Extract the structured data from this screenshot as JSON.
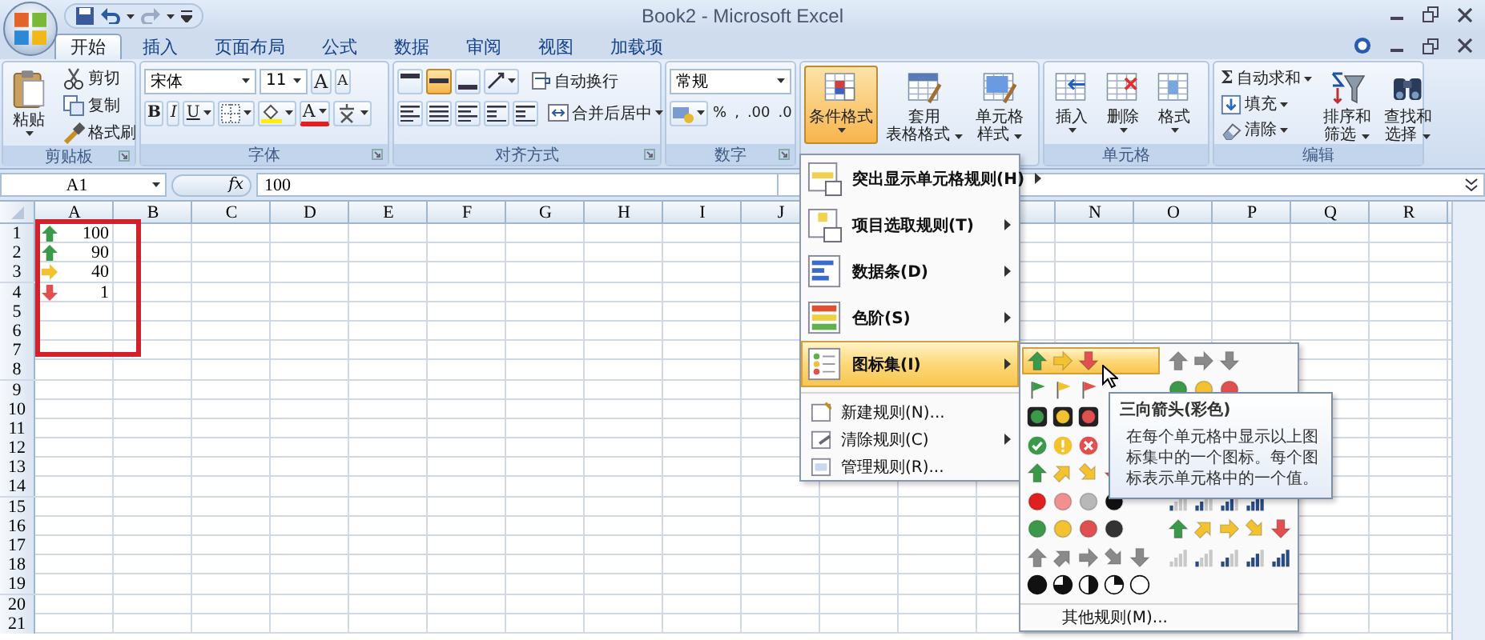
{
  "window": {
    "title": "Book2 - Microsoft Excel"
  },
  "tabs": [
    {
      "label": "开始",
      "selected": true
    },
    {
      "label": "插入",
      "selected": false
    },
    {
      "label": "页面布局",
      "selected": false
    },
    {
      "label": "公式",
      "selected": false
    },
    {
      "label": "数据",
      "selected": false
    },
    {
      "label": "审阅",
      "selected": false
    },
    {
      "label": "视图",
      "selected": false
    },
    {
      "label": "加载项",
      "selected": false
    }
  ],
  "ribbon": {
    "groups": [
      {
        "kind": "clipboard",
        "label": "剪贴板",
        "paste": "粘贴",
        "items": [
          "剪切",
          "复制",
          "格式刷"
        ]
      },
      {
        "kind": "font",
        "label": "字体",
        "font_name": "宋体",
        "font_size": "11",
        "size_buttons": [
          "A",
          "A"
        ],
        "style_buttons": [
          "B",
          "I",
          "U"
        ],
        "font_color_button": "A"
      },
      {
        "kind": "alignment",
        "label": "对齐方式",
        "align_buttons": [
          {
            "selected": false
          },
          {
            "selected": true
          },
          {
            "selected": false
          }
        ],
        "wrap_button": "自动换行",
        "merge_button": "合并后居中"
      },
      {
        "kind": "number",
        "label": "数字",
        "format": "常规",
        "buttons": [
          "%",
          ",",
          ".00",
          ".0"
        ]
      },
      {
        "kind": "styles",
        "buttons": [
          {
            "lines": [
              "条件格式"
            ],
            "pressed": true
          },
          {
            "lines": [
              "套用",
              "表格格式"
            ],
            "pressed": false
          },
          {
            "lines": [
              "单元格",
              "样式"
            ],
            "pressed": false
          }
        ]
      },
      {
        "kind": "cells",
        "label": "单元格",
        "buttons": [
          {
            "lines": [
              "插入"
            ],
            "pressed": false
          },
          {
            "lines": [
              "删除"
            ],
            "pressed": false
          },
          {
            "lines": [
              "格式"
            ],
            "pressed": false
          }
        ]
      },
      {
        "kind": "editing",
        "label": "编辑",
        "items": [
          {
            "symbol": "Σ",
            "label": "自动求和"
          },
          {
            "label": "填充"
          },
          {
            "label": "清除"
          }
        ],
        "buttons": [
          {
            "lines": [
              "排序和",
              "筛选"
            ],
            "pressed": false
          },
          {
            "lines": [
              "查找和",
              "选择"
            ],
            "pressed": false
          }
        ]
      }
    ]
  },
  "formula_bar": {
    "name_box": "A1",
    "fx": "fx",
    "value": "100"
  },
  "sheet": {
    "columns": [
      {
        "label": "A"
      },
      {
        "label": "B"
      },
      {
        "label": "C"
      },
      {
        "label": "D"
      },
      {
        "label": "E"
      },
      {
        "label": "F"
      },
      {
        "label": "G"
      },
      {
        "label": "H"
      },
      {
        "label": "I"
      },
      {
        "label": "J"
      },
      {},
      {},
      {},
      {
        "label": "N"
      },
      {
        "label": "O"
      },
      {
        "label": "P"
      },
      {
        "label": "Q"
      },
      {
        "label": "R"
      }
    ],
    "rows": [
      {
        "label": "1",
        "cells": [
          {
            "kind": "arrow-up",
            "value": "100"
          }
        ]
      },
      {
        "label": "2",
        "cells": [
          {
            "kind": "arrow-up",
            "value": "90"
          }
        ]
      },
      {
        "label": "3",
        "cells": [
          {
            "kind": "arrow-right",
            "value": "40"
          }
        ]
      },
      {
        "label": "4",
        "cells": [
          {
            "kind": "arrow-down",
            "value": "1"
          }
        ]
      },
      {
        "label": "5"
      },
      {
        "label": "6"
      },
      {
        "label": "7"
      },
      {
        "label": "8"
      },
      {
        "label": "9"
      },
      {
        "label": "10"
      },
      {
        "label": "11"
      },
      {
        "label": "12"
      },
      {
        "label": "13"
      },
      {
        "label": "14"
      },
      {
        "label": "15"
      },
      {
        "label": "16"
      },
      {
        "label": "17"
      },
      {
        "label": "18"
      },
      {
        "label": "19"
      },
      {
        "label": "20"
      },
      {
        "label": "21"
      }
    ]
  },
  "conditional_menu": {
    "items": [
      {
        "kind": "large",
        "label": "突出显示单元格规则(H)",
        "submenu": true,
        "selected": false
      },
      {
        "kind": "large",
        "label": "项目选取规则(T)",
        "submenu": true,
        "selected": false
      },
      {
        "kind": "large",
        "label": "数据条(D)",
        "submenu": true,
        "selected": false
      },
      {
        "kind": "large",
        "label": "色阶(S)",
        "submenu": true,
        "selected": false
      },
      {
        "kind": "large",
        "label": "图标集(I)",
        "submenu": true,
        "selected": true
      },
      {
        "kind": "small",
        "label": "新建规则(N)...",
        "submenu": false,
        "selected": false
      },
      {
        "kind": "small",
        "label": "清除规则(C)",
        "submenu": true,
        "selected": false
      },
      {
        "kind": "small",
        "label": "管理规则(R)...",
        "submenu": false,
        "selected": false
      }
    ]
  },
  "icon_set_menu": {
    "left": [
      {
        "kind": "arrows3",
        "selected": true
      },
      {
        "kind": "flags3",
        "selected": false
      },
      {
        "kind": "lights3r",
        "selected": false
      },
      {
        "kind": "symbols3",
        "selected": false
      },
      {
        "kind": "arrows4",
        "selected": false
      },
      {
        "kind": "redblack4",
        "selected": false
      },
      {
        "kind": "lights4",
        "selected": false
      },
      {
        "kind": "arrows5gray",
        "selected": false
      },
      {
        "kind": "quarters5",
        "selected": false
      }
    ],
    "right": [
      {
        "kind": "arrows3gray",
        "selected": false
      },
      {
        "kind": "lights3",
        "selected": false
      },
      {
        "kind": "signal4",
        "selected": false
      },
      {
        "kind": "arrows5",
        "selected": false
      },
      {
        "kind": "signal5",
        "selected": false
      }
    ],
    "footer": "其他规则(M)..."
  },
  "tooltip": {
    "title": "三向箭头(彩色)",
    "text": "在每个单元格中显示以上图标集中的一个图标。每个图标表示单元格中的一个值。"
  }
}
